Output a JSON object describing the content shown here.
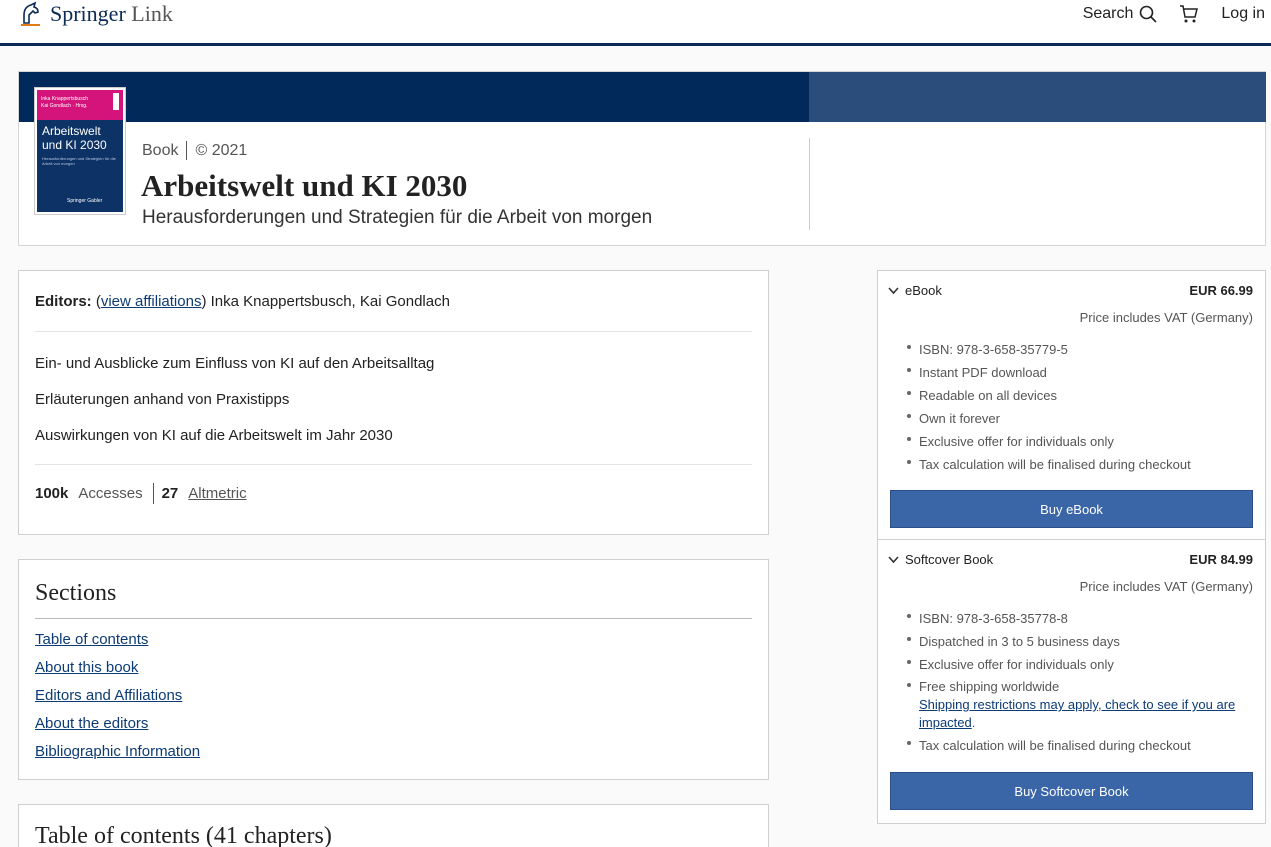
{
  "header": {
    "brand_main": "Springer",
    "brand_sub": "Link",
    "search_label": "Search",
    "login_label": "Log in"
  },
  "book": {
    "cover": {
      "names": "Inka Knappertsbusch\nKai Gondlach · Hrsg.",
      "title": "Arbeitswelt und KI 2030",
      "subtitle": "Herausforderungen und Strategien für die Arbeit von morgen",
      "publisher": "Springer Gabler"
    },
    "type": "Book",
    "year": "© 2021",
    "title": "Arbeitswelt und KI 2030",
    "subtitle": "Herausforderungen und Strategien für die Arbeit von morgen"
  },
  "info": {
    "editors_label": "Editors:",
    "affiliations_open": "(",
    "affiliations_link": "view affiliations",
    "affiliations_close": ")",
    "editors": "Inka Knappertsbusch, Kai Gondlach",
    "highlights": [
      "Ein- und Ausblicke zum Einfluss von KI auf den Arbeitsalltag",
      "Erläuterungen anhand von Praxistipps",
      "Auswirkungen von KI auf die Arbeitswelt im Jahr 2030"
    ],
    "accesses_value": "100k",
    "accesses_label": "Accesses",
    "altmetric_value": "27",
    "altmetric_label": "Altmetric"
  },
  "sections": {
    "heading": "Sections",
    "links": [
      "Table of contents",
      "About this book",
      "Editors and Affiliations",
      "About the editors",
      "Bibliographic Information"
    ]
  },
  "toc": {
    "heading": "Table of contents (41 chapters)"
  },
  "purchase": {
    "ebook": {
      "label": "eBook",
      "price": "EUR 66.99",
      "vat": "Price includes VAT (Germany)",
      "features": [
        "ISBN: 978-3-658-35779-5",
        "Instant PDF download",
        "Readable on all devices",
        "Own it forever",
        "Exclusive offer for individuals only",
        "Tax calculation will be finalised during checkout"
      ],
      "button": "Buy eBook"
    },
    "softcover": {
      "label": "Softcover Book",
      "price": "EUR 84.99",
      "vat": "Price includes VAT (Germany)",
      "features": [
        "ISBN: 978-3-658-35778-8",
        "Dispatched in 3 to 5 business days",
        "Exclusive offer for individuals only",
        "Free shipping worldwide"
      ],
      "shipping_link": "Shipping restrictions may apply, check to see if you are impacted",
      "shipping_link_tail": ".",
      "tax_note": "Tax calculation will be finalised during checkout",
      "button": "Buy Softcover Book"
    }
  },
  "colors": {
    "navy": "#012a5b",
    "band_right": "#2b4d7c",
    "button": "#3a65a6",
    "link": "#0c3b75",
    "cover_pink": "#d4147a"
  }
}
